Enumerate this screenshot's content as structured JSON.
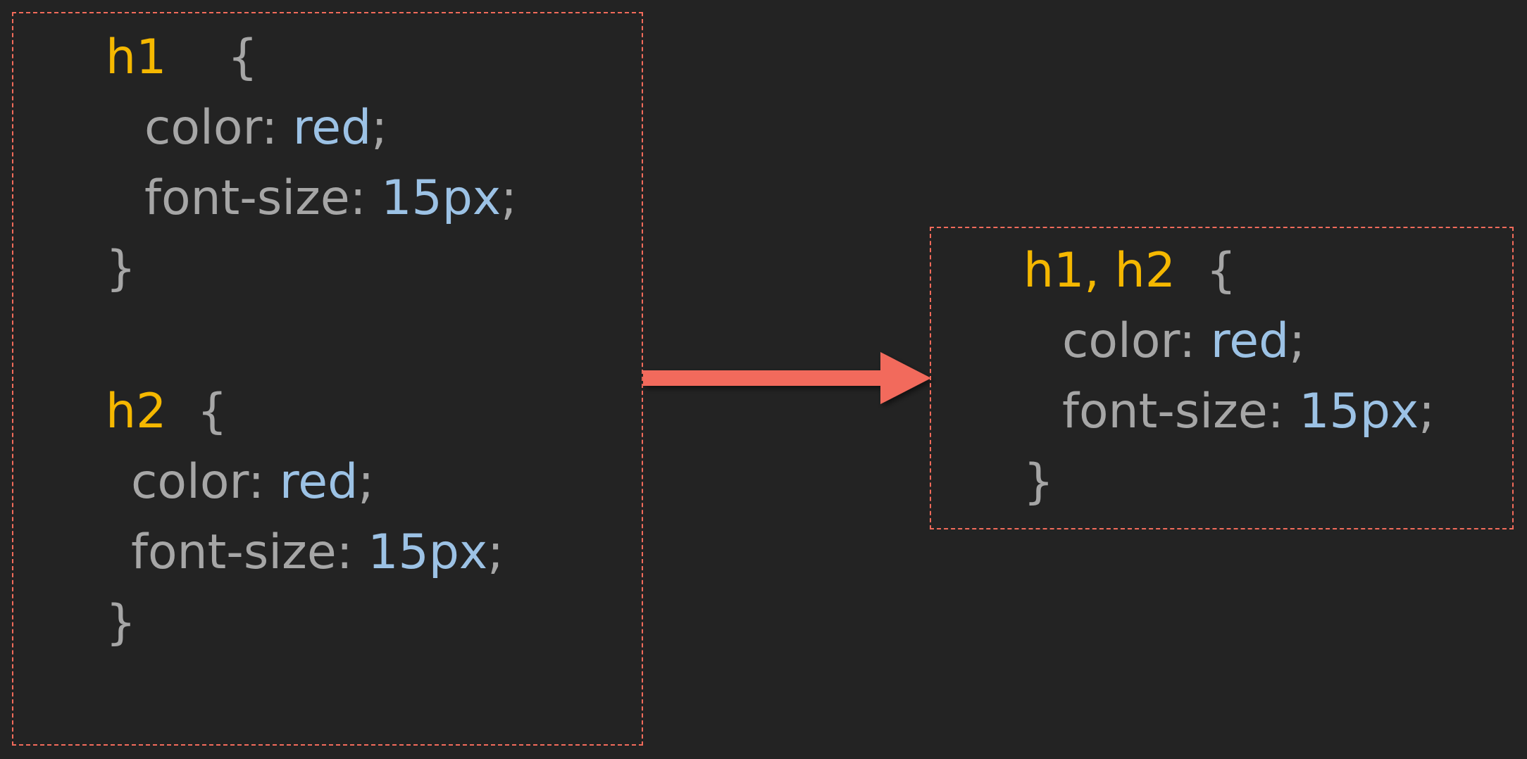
{
  "colors": {
    "background": "#232323",
    "frame": "#f26b5b",
    "selector": "#f5b800",
    "property": "#a6a6a6",
    "value": "#9cc2e5",
    "arrow": "#f26b5b"
  },
  "before": {
    "h1_rule": {
      "selector": "h1",
      "open": "{",
      "color_prop": "color: ",
      "color_val": "red",
      "size_prop": "font-size: ",
      "size_val": "15px",
      "end": ";",
      "close": "}"
    },
    "h2_rule": {
      "selector": "h2",
      "open": "{",
      "color_prop": "color: ",
      "color_val": "red",
      "size_prop": "font-size: ",
      "size_val": "15px",
      "end": ";",
      "close": "}"
    }
  },
  "after": {
    "selector_1": "h1",
    "separator": ", ",
    "selector_2": "h2",
    "open": "{",
    "color_prop": "color: ",
    "color_val": "red",
    "size_prop": "font-size: ",
    "size_val": "15px",
    "end": ";",
    "close": "}"
  },
  "arrow_icon": "right-arrow-icon"
}
